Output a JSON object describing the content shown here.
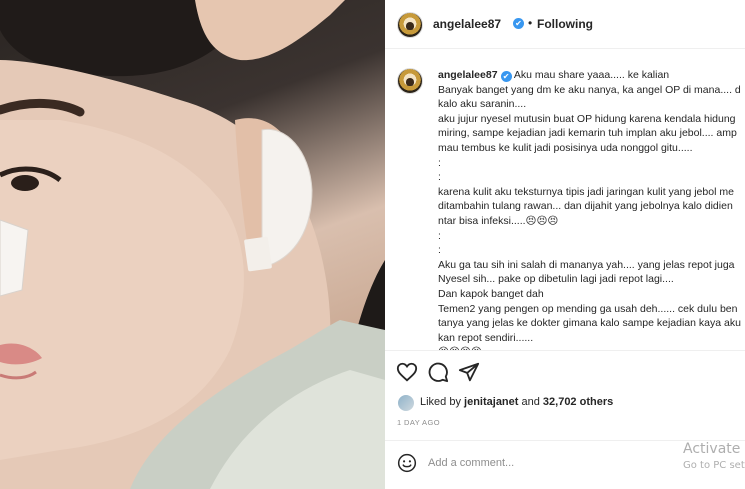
{
  "post": {
    "username": "angelalee87",
    "follow_status": "Following",
    "separator": "•",
    "verified_mark": "✔",
    "icons": {
      "verified": "verified-badge-icon",
      "more": "more-options-icon"
    }
  },
  "caption": {
    "username": "angelalee87",
    "lines": [
      " Aku mau share yaaa..... ke kalian",
      "Banyak banget yang dm ke aku nanya, ka angel OP di mana.... d",
      "kalo aku saranin....",
      "aku jujur nyesel mutusin buat OP hidung karena kendala hidung",
      "miring, sampe kejadian jadi kemarin tuh implan aku jebol.... amp",
      "mau tembus ke kulit jadi posisinya uda nonggol gitu.....",
      ":",
      ":",
      "karena kulit aku teksturnya tipis jadi jaringan kulit yang jebol me",
      "ditambahin tulang rawan... dan dijahit yang jebolnya kalo didien",
      "ntar bisa infeksi.....😣😣😣",
      ":",
      ":",
      "Aku ga tau sih ini salah di mananya yah.... yang jelas repot juga",
      "Nyesel sih... pake op dibetulin lagi jadi repot lagi....",
      "Dan kapok banget dah",
      "Temen2 yang pengen op mending ga usah deh...... cek dulu ben",
      "tanya yang jelas ke dokter gimana kalo sampe kejadian kaya aku",
      "kan repot sendiri......",
      "😣😣😣😣"
    ]
  },
  "actions": {
    "icons": [
      "heart-icon",
      "comment-icon",
      "share-icon"
    ]
  },
  "likes": {
    "prefix": "Liked by ",
    "first_user": "jenitajanet",
    "middle": " and ",
    "count": "32,702 others"
  },
  "timestamp": "1 DAY AGO",
  "comment": {
    "placeholder": "Add a comment...",
    "emoji_icon": "emoji-icon"
  },
  "watermark": {
    "line1": "Activate W",
    "line2": "Go to PC set"
  },
  "colors": {
    "text": "#262626",
    "secondary": "#8e8e8e",
    "verified": "#3897f0",
    "divider": "#efefef"
  }
}
